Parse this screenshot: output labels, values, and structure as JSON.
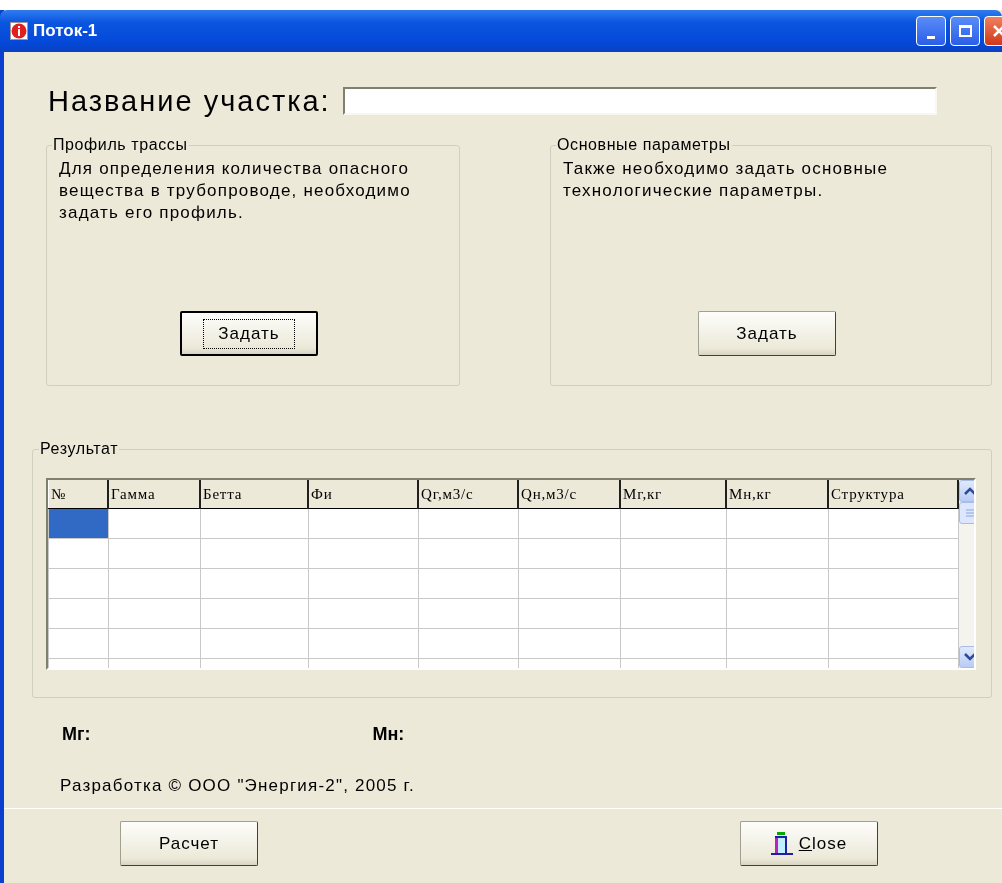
{
  "window": {
    "title": "Поток-1",
    "controls": [
      {
        "kind": "minimize"
      },
      {
        "kind": "maximize"
      },
      {
        "kind": "close"
      }
    ]
  },
  "name_field": {
    "label": "Название участка:"
  },
  "groups": [
    {
      "title": "Профиль трассы",
      "text": "Для определения количества опасного вещества в трубопроводе, необходимо задать его профиль.",
      "button": {
        "label": "Задать",
        "default": true
      }
    },
    {
      "title": "Основные параметры",
      "text": "Также необходимо задать основные технологические параметры.",
      "button": {
        "label": "Задать",
        "default": false
      }
    }
  ],
  "result": {
    "title": "Результат",
    "columns": [
      "№",
      "Гамма",
      "Бетта",
      "Фи",
      "Qг,м3/с",
      "Qн,м3/с",
      "Мг,кг",
      "Мн,кг",
      "Структура"
    ],
    "rows": [
      {
        "selected": true
      },
      {
        "selected": false
      },
      {
        "selected": false
      },
      {
        "selected": false
      },
      {
        "selected": false
      },
      {
        "selected": false
      }
    ]
  },
  "totals": [
    {
      "label": "Мг:"
    },
    {
      "label": "Мн:"
    }
  ],
  "footer": "Разработка © ООО \"Энергия-2\", 2005 г.",
  "buttons": [
    {
      "kind": "plain",
      "label": "Расчет"
    },
    {
      "kind": "exit",
      "label": "Close",
      "mnemonic_underlined": true
    }
  ]
}
